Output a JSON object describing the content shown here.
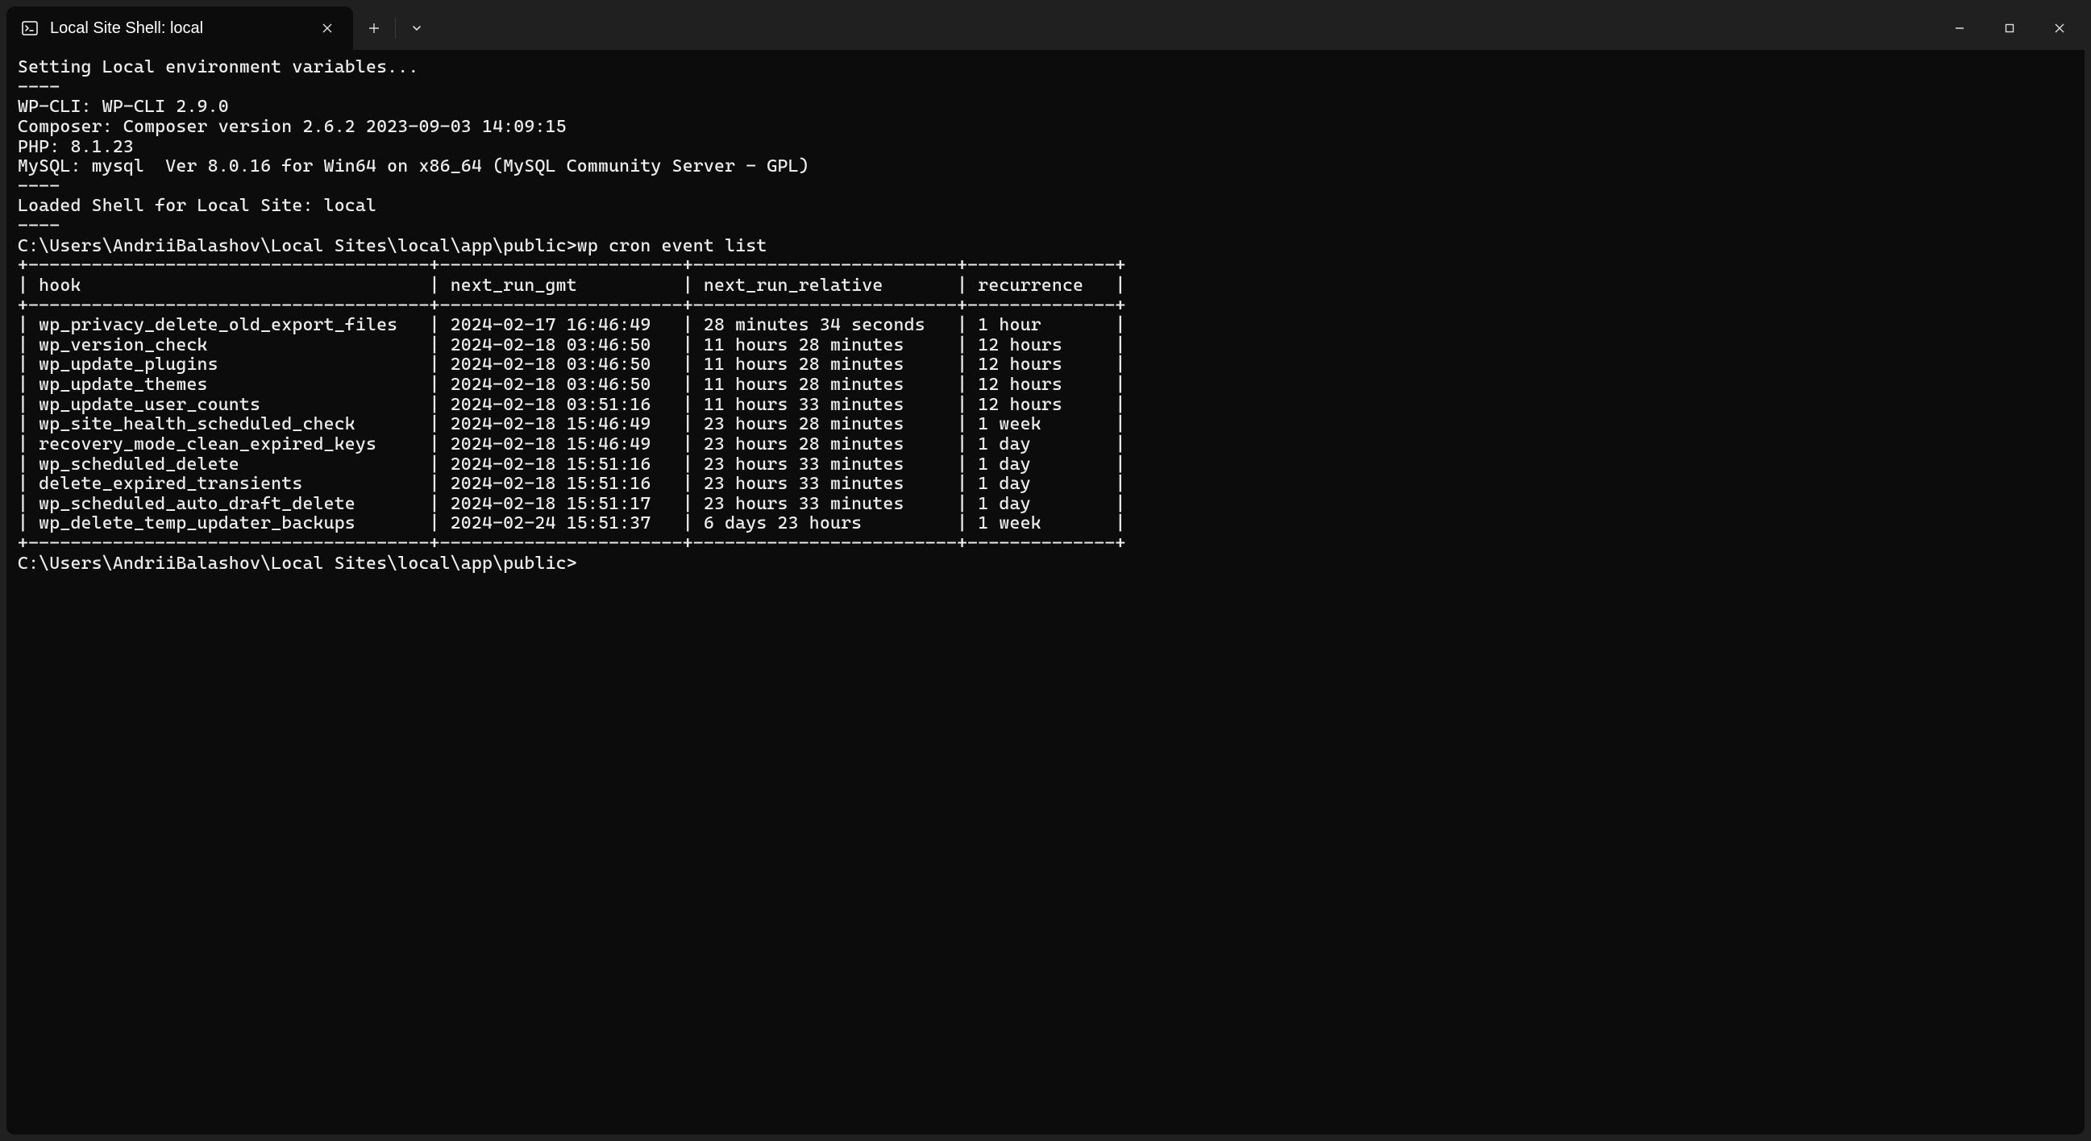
{
  "titlebar": {
    "tab_title": "Local Site Shell: local"
  },
  "terminal": {
    "intro": {
      "line1": "Setting Local environment variables...",
      "dashes": "----",
      "wpcli": "WP-CLI: WP-CLI 2.9.0",
      "composer": "Composer: Composer version 2.6.2 2023-09-03 14:09:15",
      "php": "PHP: 8.1.23",
      "mysql": "MySQL: mysql  Ver 8.0.16 for Win64 on x86_64 (MySQL Community Server - GPL)",
      "dashes2": "----",
      "loaded": "Loaded Shell for Local Site: local",
      "dashes3": "----"
    },
    "prompt_path": "C:\\Users\\AndriiBalashov\\Local Sites\\local\\app\\public>",
    "command": "wp cron event list",
    "table": {
      "col_widths": {
        "hook": 36,
        "gmt": 21,
        "rel": 23,
        "rec": 12
      },
      "headers": {
        "hook": "hook",
        "gmt": "next_run_gmt",
        "rel": "next_run_relative",
        "rec": "recurrence"
      },
      "rows": [
        {
          "hook": "wp_privacy_delete_old_export_files",
          "gmt": "2024-02-17 16:46:49",
          "rel": "28 minutes 34 seconds",
          "rec": "1 hour"
        },
        {
          "hook": "wp_version_check",
          "gmt": "2024-02-18 03:46:50",
          "rel": "11 hours 28 minutes",
          "rec": "12 hours"
        },
        {
          "hook": "wp_update_plugins",
          "gmt": "2024-02-18 03:46:50",
          "rel": "11 hours 28 minutes",
          "rec": "12 hours"
        },
        {
          "hook": "wp_update_themes",
          "gmt": "2024-02-18 03:46:50",
          "rel": "11 hours 28 minutes",
          "rec": "12 hours"
        },
        {
          "hook": "wp_update_user_counts",
          "gmt": "2024-02-18 03:51:16",
          "rel": "11 hours 33 minutes",
          "rec": "12 hours"
        },
        {
          "hook": "wp_site_health_scheduled_check",
          "gmt": "2024-02-18 15:46:49",
          "rel": "23 hours 28 minutes",
          "rec": "1 week"
        },
        {
          "hook": "recovery_mode_clean_expired_keys",
          "gmt": "2024-02-18 15:46:49",
          "rel": "23 hours 28 minutes",
          "rec": "1 day"
        },
        {
          "hook": "wp_scheduled_delete",
          "gmt": "2024-02-18 15:51:16",
          "rel": "23 hours 33 minutes",
          "rec": "1 day"
        },
        {
          "hook": "delete_expired_transients",
          "gmt": "2024-02-18 15:51:16",
          "rel": "23 hours 33 minutes",
          "rec": "1 day"
        },
        {
          "hook": "wp_scheduled_auto_draft_delete",
          "gmt": "2024-02-18 15:51:17",
          "rel": "23 hours 33 minutes",
          "rec": "1 day"
        },
        {
          "hook": "wp_delete_temp_updater_backups",
          "gmt": "2024-02-24 15:51:37",
          "rel": "6 days 23 hours",
          "rec": "1 week"
        }
      ]
    }
  }
}
